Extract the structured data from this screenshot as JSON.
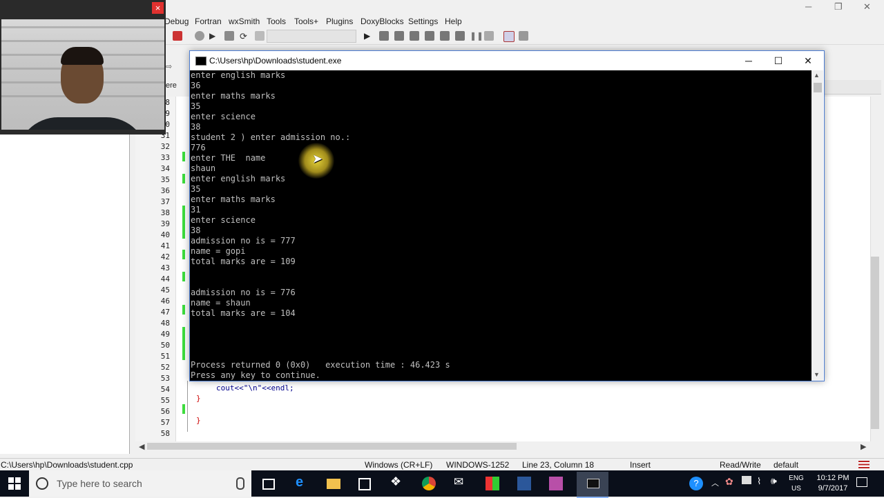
{
  "ide": {
    "menu": [
      "Debug",
      "Fortran",
      "wxSmith",
      "Tools",
      "Tools+",
      "Plugins",
      "DoxyBlocks",
      "Settings",
      "Help"
    ],
    "tab_label": "ere",
    "line_numbers": [
      "8",
      "9",
      "0",
      "31",
      "32",
      "33",
      "34",
      "35",
      "36",
      "37",
      "38",
      "39",
      "40",
      "41",
      "42",
      "43",
      "44",
      "45",
      "46",
      "47",
      "48",
      "49",
      "50",
      "51",
      "52",
      "53",
      "54",
      "55",
      "56",
      "57",
      "58"
    ],
    "code_line": "cout<<\"\\n\"<<endl;",
    "brace_close": "}",
    "fold_minus": "-"
  },
  "console": {
    "title": "C:\\Users\\hp\\Downloads\\student.exe",
    "minimize": "─",
    "maximize": "☐",
    "close": "✕",
    "output": "enter english marks\n36\nenter maths marks\n35\nenter science\n38\nstudent 2 ) enter admission no.:\n776\nenter THE  name\nshaun\nenter english marks\n35\nenter maths marks\n31\nenter science\n38\nadmission no is = 777\nname = gopi\ntotal marks are = 109\n\n\nadmission no is = 776\nname = shaun\ntotal marks are = 104\n\n\n\n\nProcess returned 0 (0x0)   execution time : 46.423 s\nPress any key to continue."
  },
  "webcam": {
    "close": "×"
  },
  "statusbar": {
    "path": "C:\\Users\\hp\\Downloads\\student.cpp",
    "eol": "Windows (CR+LF)",
    "encoding": "WINDOWS-1252",
    "position": "Line 23, Column 18",
    "mode": "Insert",
    "access": "Read/Write",
    "profile": "default"
  },
  "taskbar": {
    "search_placeholder": "Type here to search",
    "lang_top": "ENG",
    "lang_bottom": "US",
    "time": "10:12 PM",
    "date": "9/7/2017"
  },
  "colors": {
    "console_bg": "#000000",
    "console_text": "#c0c0c0",
    "changebar": "#3ddc3d",
    "cursor_highlight": "#e6c828",
    "taskbar_bg": "#0a0f1a"
  }
}
